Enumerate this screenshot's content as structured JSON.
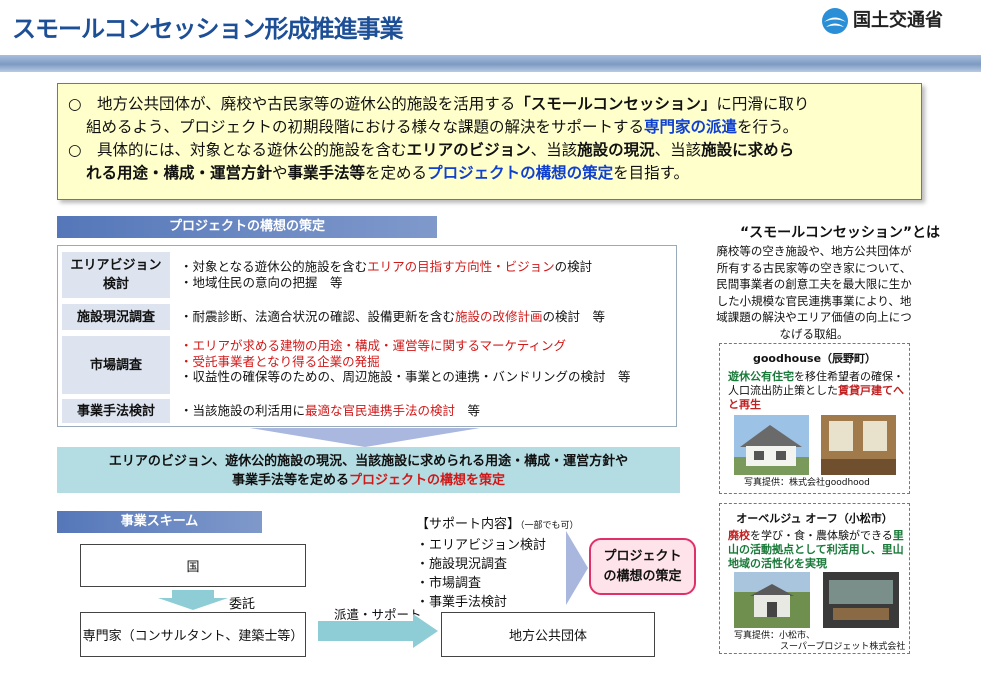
{
  "header": {
    "title": "スモールコンセッション形成推進事業",
    "ministry": "国土交通省"
  },
  "intro": {
    "l1_a": "○　地方公共団体が、廃校や古民家等の遊休公的施設を活用する",
    "l1_b": "「スモールコンセッション」",
    "l1_c": "に円滑に取り",
    "l2_a": "組めるよう、プロジェクトの初期段階における様々な課題の解決をサポートする",
    "l2_b": "専門家の派遣",
    "l2_c": "を行う。",
    "l3_a": "○　具体的には、対象となる遊休公的施設を含む",
    "l3_b": "エリアのビジョン",
    "l3_c": "、当該",
    "l3_d": "施設の現況",
    "l3_e": "、当該",
    "l3_f": "施設に求めら",
    "l4_a": "れる用途・構成・運営方針",
    "l4_b": "や",
    "l4_c": "事業手法等",
    "l4_d": "を定める",
    "l4_e": "プロジェクトの構想の策定",
    "l4_f": "を目指す。"
  },
  "project": {
    "heading": "プロジェクトの構想の策定",
    "row1": {
      "label_1": "エリアビジョン",
      "label_2": "検討",
      "a1": "・対象となる遊休公的施設を含む",
      "a2": "エリアの目指す方向性・ビジョン",
      "a3": "の検討",
      "b": "・地域住民の意向の把握　等"
    },
    "row2": {
      "label": "施設現況調査",
      "a1": "・耐震診断、法適合状況の確認、設備更新を含む",
      "a2": "施設の改修計画",
      "a3": "の検討　等"
    },
    "row3": {
      "label": "市場調査",
      "a": "・エリアが求める建物の用途・構成・運営等に関するマーケティング",
      "b": "・受託事業者となり得る企業の発掘",
      "c": "・収益性の確保等のための、周辺施設・事業との連携・バンドリングの検討　等"
    },
    "row4": {
      "label": "事業手法検討",
      "a1": "・当該施設の利活用に",
      "a2": "最適な官民連携手法の検討",
      "a3": "　等"
    }
  },
  "result": {
    "line1": "エリアのビジョン、遊休公的施設の現況、当該施設に求められる用途・構成・運営方針や",
    "line2_a": "事業手法等を定める",
    "line2_b": "プロジェクトの構想を策定"
  },
  "scheme": {
    "heading": "事業スキーム",
    "national": "国",
    "entrust": "委託",
    "expert": "専門家（コンサルタント、建築士等）",
    "dispatch": "派遣・サポート",
    "local_gov": "地方公共団体",
    "support_title": "【サポート内容】",
    "support_note": "（一部でも可）",
    "support_items": [
      "・エリアビジョン検討",
      "・施設現況調査",
      "・市場調査",
      "・事業手法検討"
    ],
    "outcome_1": "プロジェクト",
    "outcome_2": "の構想の策定"
  },
  "small_concession": {
    "title": "“スモールコンセッション”とは",
    "desc": "廃校等の空き施設や、地方公共団体が所有する古民家等の空き家について、民間事業者の創意工夫を最大限に生かした小規模な官民連携事業により、地域課題の解決やエリア価値の向上につなげる取組。"
  },
  "case1": {
    "title": "goodhouse（辰野町）",
    "desc_a": "遊休公有住宅",
    "desc_b": "を移住希望者の確保・人口流出防止策とした",
    "desc_c": "賃貸戸建てへと再生",
    "credit": "写真提供：株式会社goodhood"
  },
  "case2": {
    "title": "オーベルジュ オーフ（小松市）",
    "desc_a": "廃校",
    "desc_b": "を学び・食・農体験ができる",
    "desc_c": "里山の活動拠点として利活用し、",
    "desc_d": "里山地域の活性化を実現",
    "credit_1": "写真提供：小松市、",
    "credit_2": "スーパープロジェット株式会社"
  },
  "colors": {
    "title": "#1d4f96",
    "emphasis_blue": "#1040d0",
    "emphasis_red": "#d01818",
    "intro_bg": "#ffffcc",
    "result_bg": "#b4dde3",
    "outcome_border": "#e0306a"
  },
  "icons": [
    "mlit-logo-icon",
    "down-arrow-icon",
    "right-arrow-icon"
  ]
}
